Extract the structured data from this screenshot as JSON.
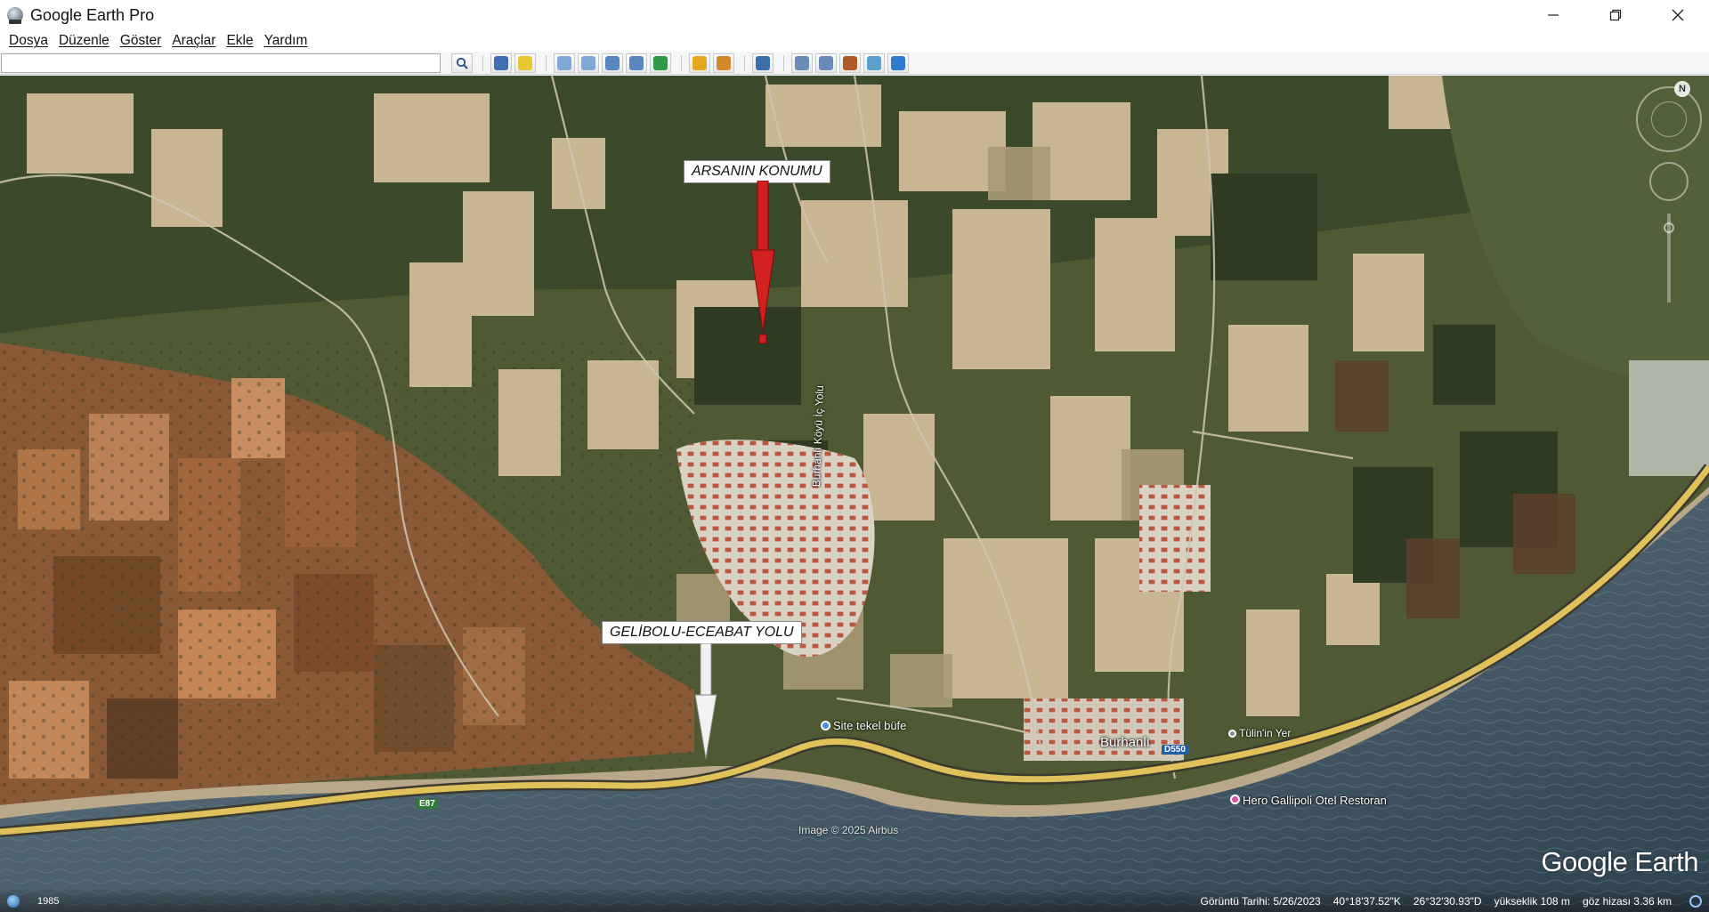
{
  "window": {
    "title": "Google Earth Pro",
    "controls": {
      "minimize": "—",
      "restore": "❐",
      "close": "✕"
    }
  },
  "menu": {
    "items": [
      {
        "label": "Dosya"
      },
      {
        "label": "Düzenle"
      },
      {
        "label": "Göster"
      },
      {
        "label": "Araçlar"
      },
      {
        "label": "Ekle"
      },
      {
        "label": "Yardım"
      }
    ]
  },
  "toolbar": {
    "search_value": "",
    "search_placeholder": "",
    "buttons": [
      {
        "icon": "sidebar-toggle-icon",
        "color": "#3f6fb0"
      },
      {
        "icon": "add-placemark-icon",
        "color": "#e8c830"
      },
      {
        "icon": "add-polygon-icon",
        "color": "#7ea8d8"
      },
      {
        "icon": "add-path-icon",
        "color": "#7ea8d8"
      },
      {
        "icon": "add-image-overlay-icon",
        "color": "#5a86c0"
      },
      {
        "icon": "record-tour-icon",
        "color": "#5a86c0"
      },
      {
        "icon": "historical-imagery-icon",
        "color": "#2e9a45"
      },
      {
        "icon": "sunlight-icon",
        "color": "#e6a820"
      },
      {
        "icon": "switch-planet-icon",
        "color": "#d08a2a"
      },
      {
        "icon": "ruler-icon",
        "color": "#3a6ea8"
      },
      {
        "icon": "email-icon",
        "color": "#6a8cb8"
      },
      {
        "icon": "print-icon",
        "color": "#6a8cb8"
      },
      {
        "icon": "save-image-icon",
        "color": "#b05a2a"
      },
      {
        "icon": "view-in-maps-icon",
        "color": "#5aa0d0"
      },
      {
        "icon": "earth-gallery-icon",
        "color": "#2f7ad0"
      }
    ]
  },
  "map": {
    "callouts": {
      "plot": "ARSANIN KONUMU",
      "road": "GELİBOLU-ECEABAT YOLU"
    },
    "labels": {
      "village": "Burhanlı",
      "street": "Burhanlı Köyü İç Yolu",
      "poi_shop": "Site tekel büfe",
      "poi_hotel": "Hero Gallipoli Otel Restoran",
      "poi_yer": "Tülin'in Yer",
      "road_e87": "E87",
      "road_d550": "D550"
    },
    "credit": "Image © 2025 Airbus",
    "watermark": "Google Earth",
    "compass_north": "N",
    "colors": {
      "sea": "#4a5e6a",
      "highway": "#e0c15a",
      "callout_arrow_red": "#d22020",
      "callout_arrow_white": "#f2f2f2",
      "poi_blue": "#4a90e2",
      "poi_pink": "#e04fa0",
      "road_shield_green": "#2e7d32",
      "road_shield_blue": "#1f5fa8"
    }
  },
  "status": {
    "year": "1985",
    "imagery_date": "Görüntü Tarihi: 5/26/2023",
    "lat": "40°18'37.52\"K",
    "lon": "26°32'30.93\"D",
    "elev": "yükseklik  108 m",
    "eye_alt": "göz hizası   3.36 km"
  }
}
